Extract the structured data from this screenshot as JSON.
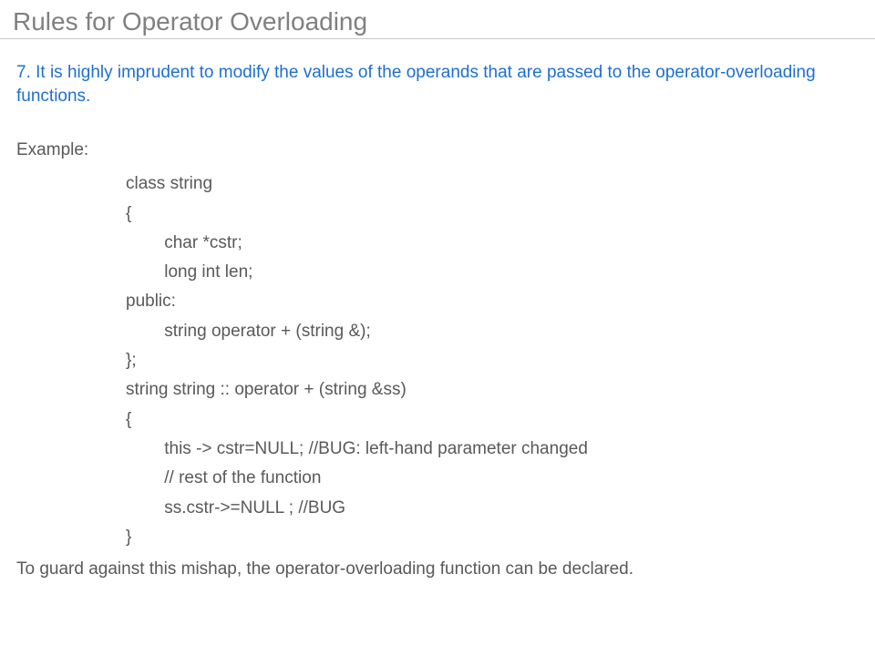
{
  "title": "Rules for Operator Overloading",
  "rule": "7. It is highly imprudent to modify the values of the operands that are passed to the operator-overloading functions.",
  "exampleLabel": "Example:",
  "code": "class string\n{\n        char *cstr;\n        long int len;\npublic:\n        string operator + (string &);\n};\nstring string :: operator + (string &ss)\n{\n        this -> cstr=NULL; //BUG: left-hand parameter changed\n        // rest of the function\n        ss.cstr->=NULL ; //BUG\n}",
  "footer": "To guard against this mishap, the operator-overloading function can be declared."
}
